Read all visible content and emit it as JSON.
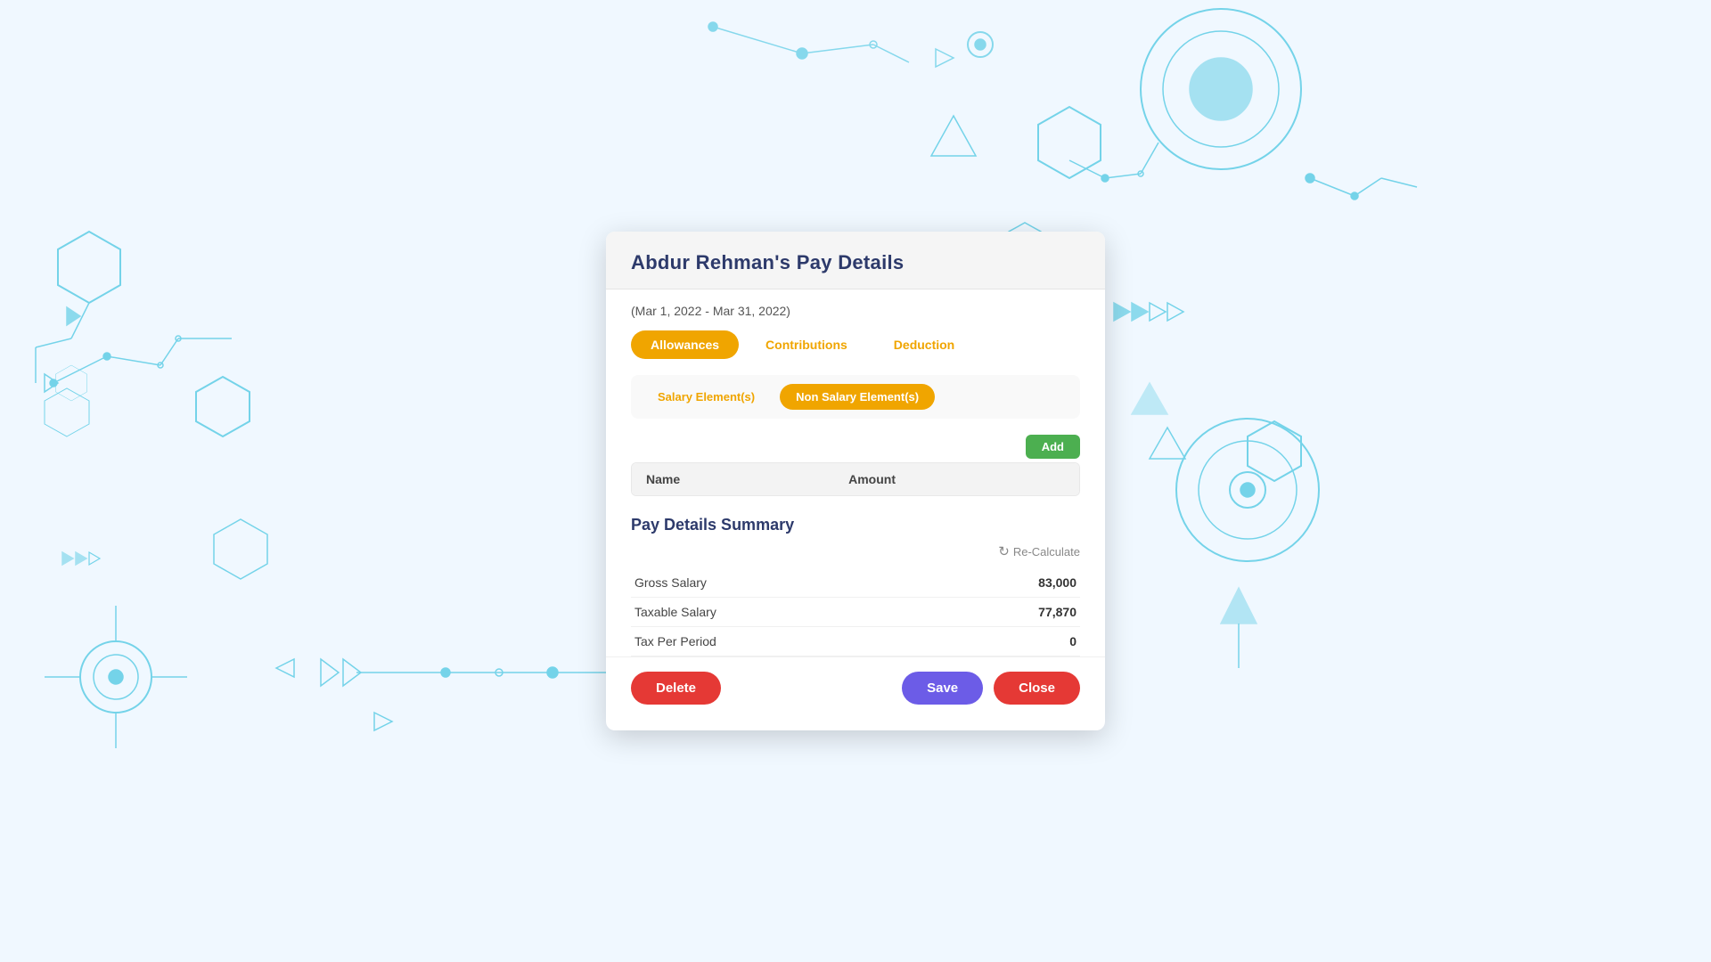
{
  "background": {
    "color": "#f0f8ff"
  },
  "modal": {
    "title": "Abdur Rehman's Pay Details",
    "date_range": "(Mar 1, 2022 - Mar 31, 2022)",
    "tabs": [
      {
        "id": "allowances",
        "label": "Allowances",
        "active": true
      },
      {
        "id": "contributions",
        "label": "Contributions",
        "active": false
      },
      {
        "id": "deduction",
        "label": "Deduction",
        "active": false
      }
    ],
    "sub_tabs": [
      {
        "id": "salary-element",
        "label": "Salary Element(s)",
        "active": false
      },
      {
        "id": "non-salary-element",
        "label": "Non Salary Element(s)",
        "active": true
      }
    ],
    "add_button_label": "Add",
    "table": {
      "columns": [
        "Name",
        "Amount"
      ],
      "rows": []
    },
    "summary": {
      "title": "Pay Details Summary",
      "recalculate_label": "Re-Calculate",
      "rows": [
        {
          "label": "Gross Salary",
          "value": "83,000"
        },
        {
          "label": "Taxable Salary",
          "value": "77,870"
        },
        {
          "label": "Tax Per Period",
          "value": "0"
        }
      ]
    },
    "footer": {
      "delete_label": "Delete",
      "save_label": "Save",
      "close_label": "Close"
    }
  }
}
